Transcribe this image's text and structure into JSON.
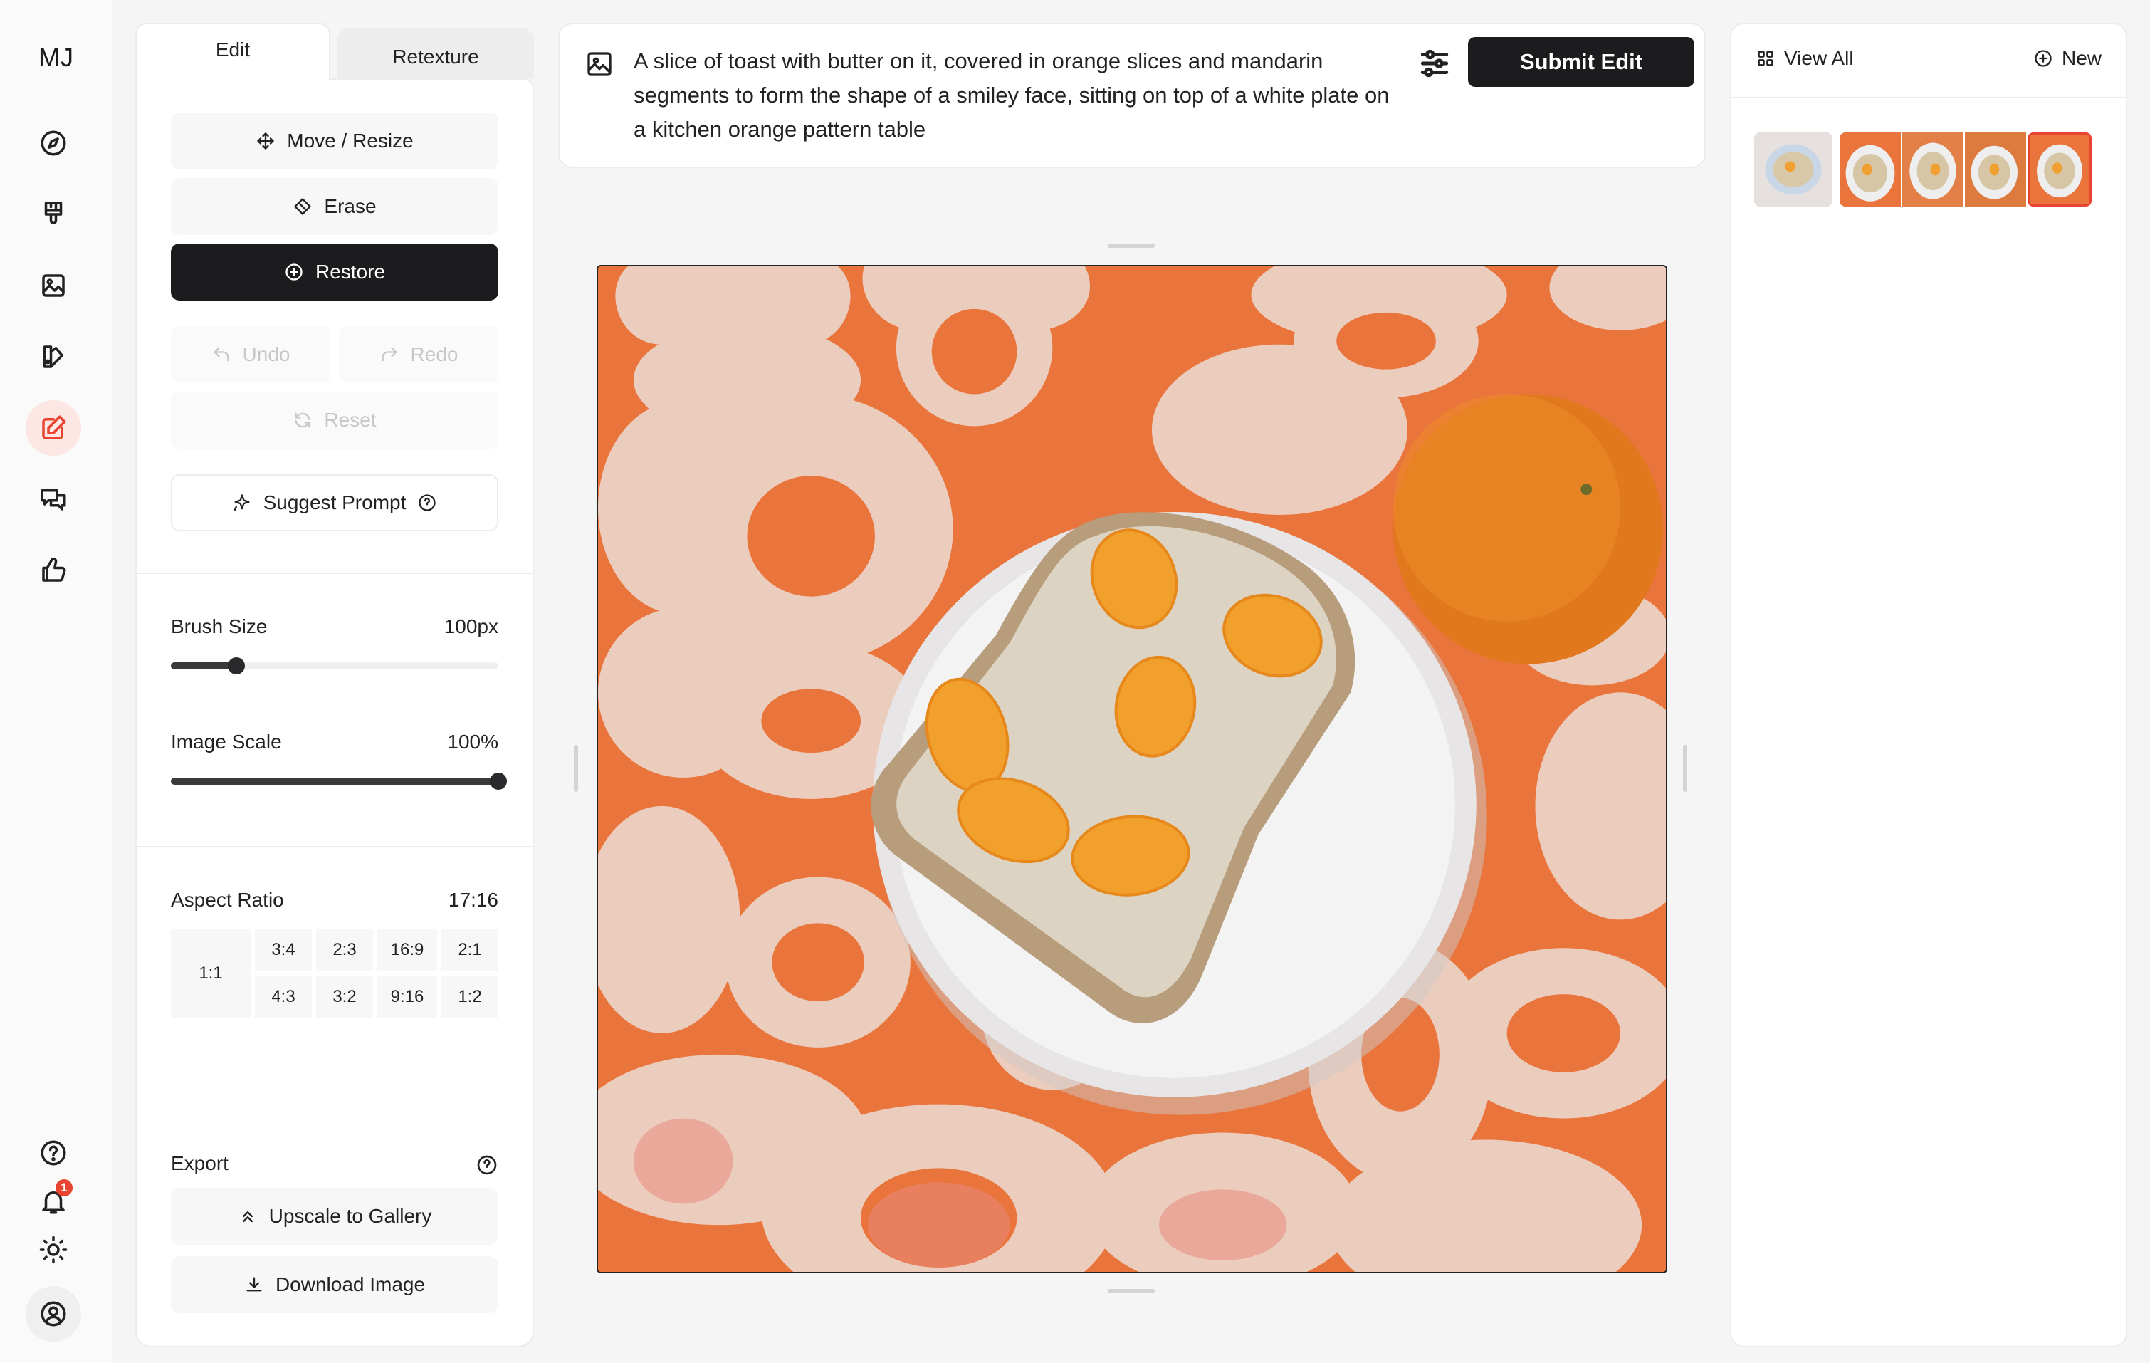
{
  "app": {
    "logo": "MJ"
  },
  "rail": {
    "items": [
      {
        "name": "explore",
        "icon": "compass-icon"
      },
      {
        "name": "create",
        "icon": "paintbrush-icon"
      },
      {
        "name": "organize",
        "icon": "image-icon"
      },
      {
        "name": "personalize",
        "icon": "swatch-icon"
      },
      {
        "name": "edit",
        "icon": "edit-icon",
        "active": true
      },
      {
        "name": "chat",
        "icon": "chat-icon"
      },
      {
        "name": "rank",
        "icon": "thumbs-up-icon"
      }
    ],
    "bottom": [
      {
        "name": "help",
        "icon": "help-icon"
      },
      {
        "name": "notifications",
        "icon": "bell-icon",
        "badge": "1"
      },
      {
        "name": "theme",
        "icon": "sun-icon"
      },
      {
        "name": "profile",
        "icon": "user-icon"
      }
    ]
  },
  "tabs": {
    "edit": "Edit",
    "retexture": "Retexture"
  },
  "tools": {
    "move_resize": "Move / Resize",
    "erase": "Erase",
    "restore": "Restore",
    "undo": "Undo",
    "redo": "Redo",
    "reset": "Reset",
    "suggest_prompt": "Suggest Prompt"
  },
  "brush": {
    "label": "Brush Size",
    "value_text": "100px",
    "fraction": 0.2
  },
  "scale": {
    "label": "Image Scale",
    "value_text": "100%",
    "fraction": 1.0
  },
  "aspect": {
    "label": "Aspect Ratio",
    "value": "17:16",
    "square": "1:1",
    "top_row": [
      "3:4",
      "2:3",
      "16:9",
      "2:1"
    ],
    "bottom_row": [
      "4:3",
      "3:2",
      "9:16",
      "1:2"
    ]
  },
  "export": {
    "label": "Export",
    "upscale": "Upscale to Gallery",
    "download": "Download Image"
  },
  "prompt": {
    "text": "A slice of toast with butter on it, covered in orange slices and mandarin segments to form the shape of a smiley face, sitting on top of a white plate on a kitchen orange pattern table",
    "submit": "Submit Edit"
  },
  "history": {
    "view_all": "View All",
    "new": "New",
    "thumbnails": 5,
    "selected_index": 4
  },
  "colors": {
    "accent": "#e8442f",
    "dark_button": "#1c1c1e",
    "table_orange": "#e9743c"
  }
}
